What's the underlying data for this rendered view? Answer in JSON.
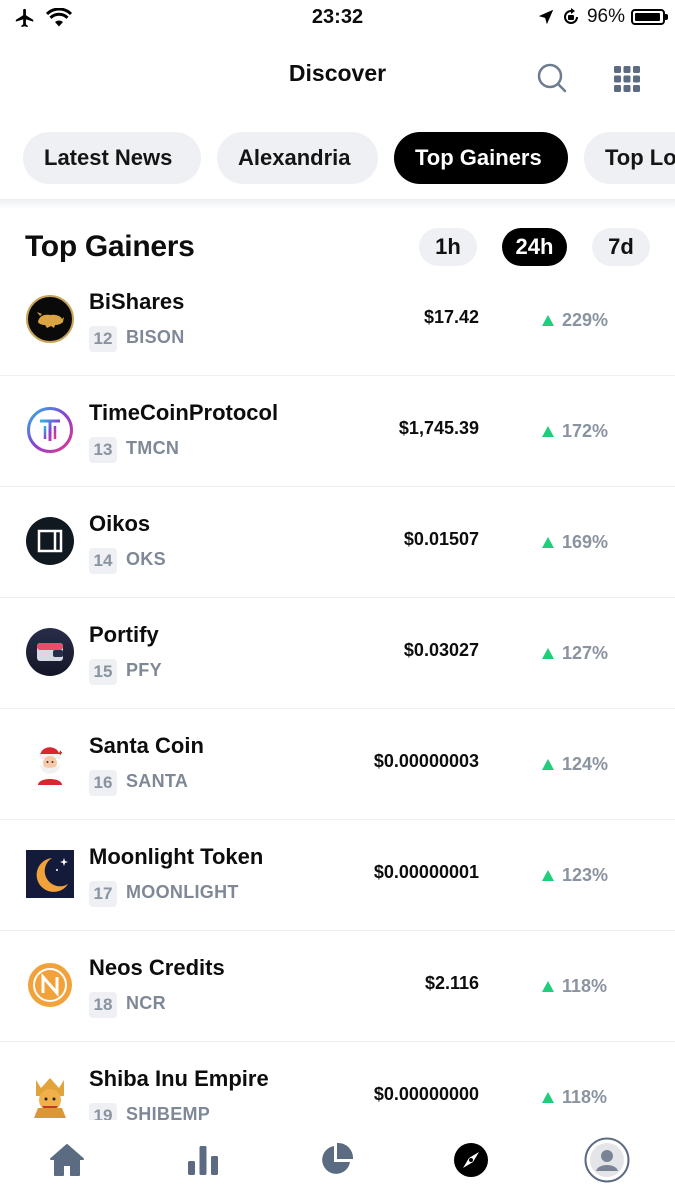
{
  "status_bar": {
    "time": "23:32",
    "battery_text": "96%",
    "battery_level": 0.96
  },
  "header": {
    "title": "Discover"
  },
  "tabs": [
    {
      "label": "Latest News",
      "active": false
    },
    {
      "label": "Alexandria",
      "active": false
    },
    {
      "label": "Top Gainers",
      "active": true
    },
    {
      "label": "Top Losers",
      "active": false
    }
  ],
  "section": {
    "title": "Top Gainers",
    "periods": [
      {
        "label": "1h",
        "active": false
      },
      {
        "label": "24h",
        "active": true
      },
      {
        "label": "7d",
        "active": false
      }
    ]
  },
  "coins": [
    {
      "name": "BiShares",
      "rank": "12",
      "symbol": "BISON",
      "price": "$17.42",
      "change": "229%",
      "icon": "bull-icon"
    },
    {
      "name": "TimeCoinProtocol",
      "rank": "13",
      "symbol": "TMCN",
      "price": "$1,745.39",
      "change": "172%",
      "icon": "t-ring-icon"
    },
    {
      "name": "Oikos",
      "rank": "14",
      "symbol": "OKS",
      "price": "$0.01507",
      "change": "169%",
      "icon": "square-logo-icon"
    },
    {
      "name": "Portify",
      "rank": "15",
      "symbol": "PFY",
      "price": "$0.03027",
      "change": "127%",
      "icon": "wallet-icon"
    },
    {
      "name": "Santa Coin",
      "rank": "16",
      "symbol": "SANTA",
      "price": "$0.00000003",
      "change": "124%",
      "icon": "santa-icon"
    },
    {
      "name": "Moonlight Token",
      "rank": "17",
      "symbol": "MOONLIGHT",
      "price": "$0.00000001",
      "change": "123%",
      "icon": "moon-icon"
    },
    {
      "name": "Neos Credits",
      "rank": "18",
      "symbol": "NCR",
      "price": "$2.116",
      "change": "118%",
      "icon": "n-coin-icon"
    },
    {
      "name": "Shiba Inu Empire",
      "rank": "19",
      "symbol": "SHIBEMP",
      "price": "$0.00000000",
      "change": "118%",
      "icon": "shiba-icon"
    }
  ],
  "colors": {
    "gain": "#1fce7a",
    "muted": "#8a93a0",
    "chip_bg": "#eef0f3",
    "nav_icon": "#5a6b82"
  },
  "bottom_nav": [
    {
      "icon": "home-icon"
    },
    {
      "icon": "bar-chart-icon"
    },
    {
      "icon": "pie-chart-icon"
    },
    {
      "icon": "compass-icon",
      "active": true
    },
    {
      "icon": "profile-icon"
    }
  ]
}
